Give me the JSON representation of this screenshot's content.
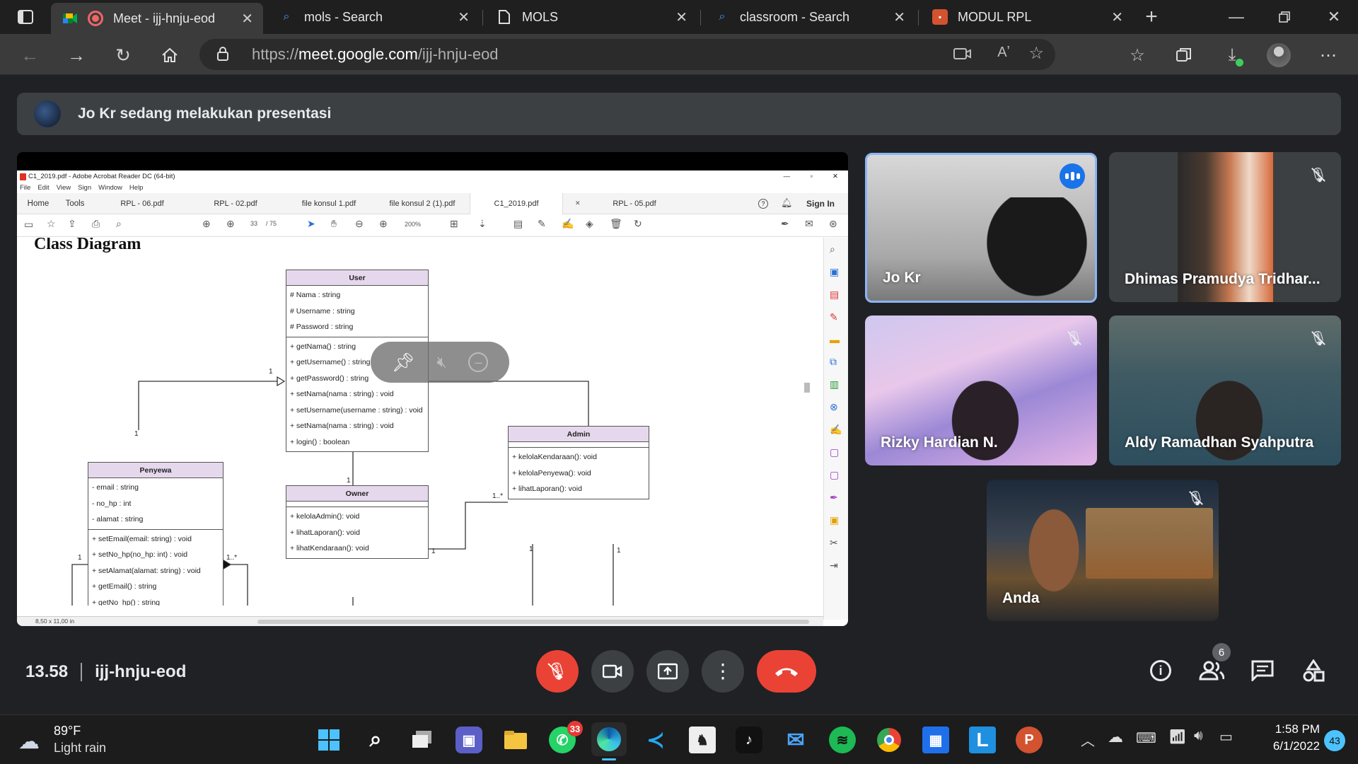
{
  "browser": {
    "tabs": [
      {
        "title": "Meet - ijj-hnju-eod",
        "icon": "google-meet-icon",
        "active": true
      },
      {
        "title": "mols - Search",
        "icon": "search-icon"
      },
      {
        "title": "MOLS",
        "icon": "document-icon"
      },
      {
        "title": "classroom - Search",
        "icon": "search-icon"
      },
      {
        "title": "MODUL RPL",
        "icon": "powerpoint-icon"
      }
    ],
    "url_prefix": "https://",
    "url_domain": "meet.google.com",
    "url_path": "/ijj-hnju-eod"
  },
  "meet": {
    "presenting_banner": "Jo Kr sedang melakukan presentasi",
    "meeting_time": "13.58",
    "meeting_code": "ijj-hnju-eod",
    "participants_count": "6",
    "participants": [
      {
        "name": "Jo Kr",
        "speaking": true
      },
      {
        "name": "Dhimas Pramudya Tridhar...",
        "muted": true
      },
      {
        "name": "Rizky Hardian N.",
        "muted": true
      },
      {
        "name": "Aldy Ramadhan Syahputra",
        "muted": true
      },
      {
        "name": "Anda",
        "muted": true
      }
    ]
  },
  "acrobat": {
    "window_title": "C1_2019.pdf - Adobe Acrobat Reader DC (64-bit)",
    "menu": [
      "File",
      "Edit",
      "View",
      "Sign",
      "Window",
      "Help"
    ],
    "home": "Home",
    "tools": "Tools",
    "tabs": [
      "RPL - 06.pdf",
      "RPL - 02.pdf",
      "file konsul 1.pdf",
      "file konsul 2 (1).pdf",
      "C1_2019.pdf",
      "RPL - 05.pdf"
    ],
    "sign_in": "Sign In",
    "page_current": "33",
    "page_total": "/ 75",
    "zoom": "200%",
    "page_size": "8,50 x 11,00 in",
    "heading": "Class Diagram",
    "classes": {
      "user": {
        "name": "User",
        "attributes": [
          "# Nama : string",
          "# Username : string",
          "# Password : string"
        ],
        "methods": [
          "+ getNama() : string",
          "+ getUsername() : string",
          "+ getPassword() : string",
          "+ setNama(nama : string) : void",
          "+ setUsername(username : string) : void",
          "+ setNama(nama : string) : void",
          "+ login() : boolean"
        ]
      },
      "penyewa": {
        "name": "Penyewa",
        "attributes": [
          "- email : string",
          "- no_hp : int",
          "- alamat : string"
        ],
        "methods": [
          "+ setEmail(email: string) : void",
          "+ setNo_hp(no_hp: int) : void",
          "+ setAlamat(alamat: string) : void",
          "+ getEmail() : string",
          "+ getNo_hp() : string"
        ]
      },
      "admin": {
        "name": "Admin",
        "methods": [
          "+ kelolaKendaraan(): void",
          "+ kelolaPenyewa(): void",
          "+ lihatLaporan(): void"
        ]
      },
      "owner": {
        "name": "Owner",
        "methods": [
          "+ kelolaAdmin(): void",
          "+ lihatLaporan(): void",
          "+ lihatKendaraan(): void"
        ]
      }
    },
    "multiplicities": {
      "m1": "1",
      "m2": "1",
      "m3": "1",
      "m4": "1",
      "m5": "1..*",
      "m6": "1",
      "m7": "1",
      "m8": "1",
      "m9": "1",
      "m10": "1..*",
      "m11": "1"
    }
  },
  "taskbar": {
    "weather_temp": "89°F",
    "weather_desc": "Light rain",
    "whatsapp_badge": "33",
    "time": "1:58 PM",
    "date": "6/1/2022",
    "notifications": "43"
  }
}
